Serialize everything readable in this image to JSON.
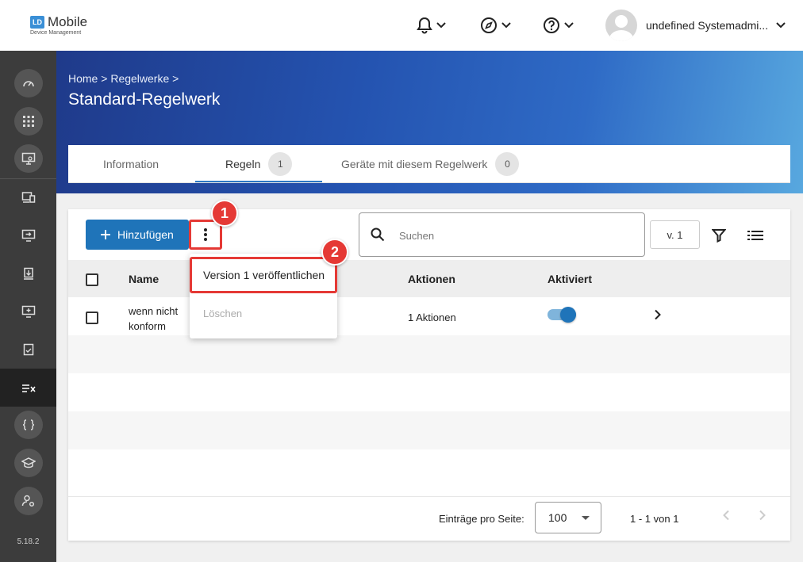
{
  "app": {
    "logo_badge": "LD",
    "logo_title": "Mobile",
    "logo_subtitle": "Device Management",
    "username": "undefined Systemadmi...",
    "version": "5.18.2"
  },
  "breadcrumb": {
    "home": "Home",
    "sep": ">",
    "parent": "Regelwerke"
  },
  "page_title": "Standard-Regelwerk",
  "tabs": [
    {
      "label": "Information"
    },
    {
      "label": "Regeln",
      "count": "1"
    },
    {
      "label": "Geräte mit diesem Regelwerk",
      "count": "0"
    }
  ],
  "toolbar": {
    "add_label": "Hinzufügen",
    "search_placeholder": "Suchen",
    "version_label": "v. 1"
  },
  "table": {
    "columns": {
      "name": "Name",
      "actions": "Aktionen",
      "active": "Aktiviert"
    },
    "rows": [
      {
        "name_line1": "wenn nicht",
        "name_line2": "konform",
        "actions": "1 Aktionen",
        "active": true
      }
    ]
  },
  "menu": {
    "items": [
      {
        "label": "Version 1 veröffentlichen"
      },
      {
        "label": "Löschen"
      }
    ]
  },
  "pagination": {
    "per_page_label": "Einträge pro Seite:",
    "per_page_value": "100",
    "range": "1 - 1 von 1"
  },
  "callouts": [
    "1",
    "2"
  ],
  "colors": {
    "primary": "#1f74b9",
    "highlight": "#e53935",
    "sidebar": "#3c3c3c"
  }
}
